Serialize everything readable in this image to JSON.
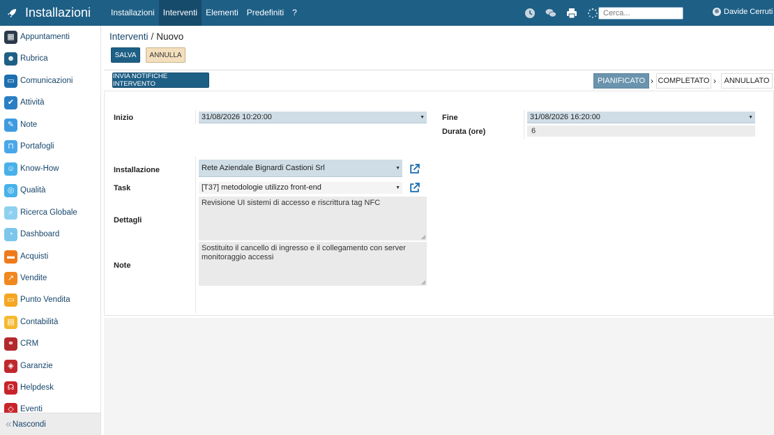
{
  "app": {
    "title": "Installazioni"
  },
  "menu": [
    {
      "label": "Installazioni",
      "active": false
    },
    {
      "label": "Interventi",
      "active": true
    },
    {
      "label": "Elementi",
      "active": false
    },
    {
      "label": "Predefiniti",
      "active": false
    },
    {
      "label": "?",
      "active": false
    }
  ],
  "toolbar_icons": [
    "clock-icon",
    "chat-icon",
    "print-icon",
    "spinner-icon"
  ],
  "search": {
    "placeholder": "Cerca..."
  },
  "user": {
    "name": "Davide Cerruti"
  },
  "sidebar": {
    "items": [
      {
        "label": "Appuntamenti",
        "icon": "calendar-icon",
        "color": "#2b3a4a"
      },
      {
        "label": "Rubrica",
        "icon": "contacts-icon",
        "color": "#1e5f86"
      },
      {
        "label": "Comunicazioni",
        "icon": "message-icon",
        "color": "#1e6fb0"
      },
      {
        "label": "Attività",
        "icon": "checkbox-icon",
        "color": "#2a7fc4"
      },
      {
        "label": "Note",
        "icon": "note-icon",
        "color": "#3f9be0"
      },
      {
        "label": "Portafogli",
        "icon": "lock-icon",
        "color": "#4aa8e8"
      },
      {
        "label": "Know-How",
        "icon": "brain-icon",
        "color": "#4ab0ea"
      },
      {
        "label": "Qualità",
        "icon": "quality-icon",
        "color": "#48b2ea"
      },
      {
        "label": "Ricerca Globale",
        "icon": "search-icon",
        "color": "#8fd0f0"
      },
      {
        "label": "Dashboard",
        "icon": "dashboard-icon",
        "color": "#7cc6ec"
      },
      {
        "label": "Acquisti",
        "icon": "purchase-icon",
        "color": "#ef7a1a"
      },
      {
        "label": "Vendite",
        "icon": "sales-icon",
        "color": "#f0871f"
      },
      {
        "label": "Punto Vendita",
        "icon": "pos-icon",
        "color": "#f5a623"
      },
      {
        "label": "Contabilità",
        "icon": "accounting-icon",
        "color": "#f5b82e"
      },
      {
        "label": "CRM",
        "icon": "handshake-icon",
        "color": "#b3282d"
      },
      {
        "label": "Garanzie",
        "icon": "shield-icon",
        "color": "#c0282e"
      },
      {
        "label": "Helpdesk",
        "icon": "headset-icon",
        "color": "#c8242b"
      },
      {
        "label": "Eventi",
        "icon": "ticket-icon",
        "color": "#c8242b"
      }
    ],
    "footer": {
      "label": "Nascondi"
    }
  },
  "breadcrumb": {
    "parent": "Interventi",
    "separator": "/",
    "current": "Nuovo"
  },
  "actions": {
    "save": "SALVA",
    "cancel": "ANNULLA",
    "notify": "INVIA NOTIFICHE INTERVENTO"
  },
  "steps": [
    {
      "label": "PIANIFICATO",
      "active": true
    },
    {
      "label": "COMPLETATO",
      "active": false
    },
    {
      "label": "ANNULLATO",
      "active": false
    }
  ],
  "form": {
    "inizio": {
      "label": "Inizio",
      "value": "31/08/2026 10:20:00"
    },
    "fine": {
      "label": "Fine",
      "value": "31/08/2026 16:20:00"
    },
    "durata": {
      "label": "Durata (ore)",
      "value": "6"
    },
    "installazione": {
      "label": "Installazione",
      "value": "Rete Aziendale Bignardi Castioni Srl"
    },
    "task": {
      "label": "Task",
      "value": "[T37] metodologie utilizzo front-end"
    },
    "dettagli": {
      "label": "Dettagli",
      "value": "Revisione UI sistemi di accesso e riscrittura tag NFC"
    },
    "note": {
      "label": "Note",
      "value": "Sostituito il cancello di ingresso e il collegamento con server monitoraggio accessi"
    }
  }
}
